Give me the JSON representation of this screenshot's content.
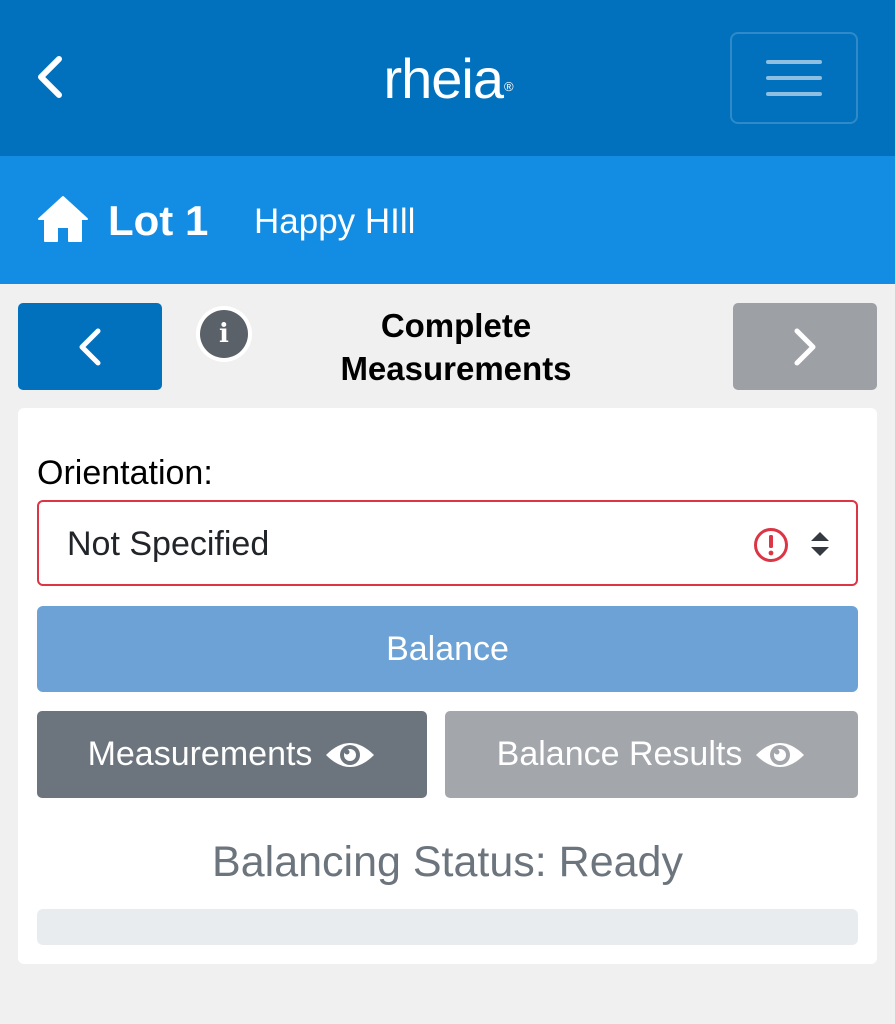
{
  "header": {
    "brand": "rheia",
    "brand_mark": "®",
    "back_icon": "chevron-left-icon",
    "menu_icon": "hamburger-menu-icon"
  },
  "lot": {
    "title": "Lot 1",
    "subtitle": "Happy HIll",
    "icon": "home-icon"
  },
  "step": {
    "title_line1": "Complete",
    "title_line2": "Measurements",
    "info_glyph": "i"
  },
  "form": {
    "orientation_label": "Orientation:",
    "orientation_value": "Not Specified"
  },
  "buttons": {
    "balance": "Balance",
    "measurements": "Measurements",
    "balance_results": "Balance Results"
  },
  "status": {
    "text": "Balancing Status: Ready",
    "progress": 0
  },
  "colors": {
    "header": "#0171bd",
    "lot_bar": "#138ce4",
    "primary": "#0171bd",
    "danger": "#dc3545",
    "secondary": "#6c757d"
  }
}
